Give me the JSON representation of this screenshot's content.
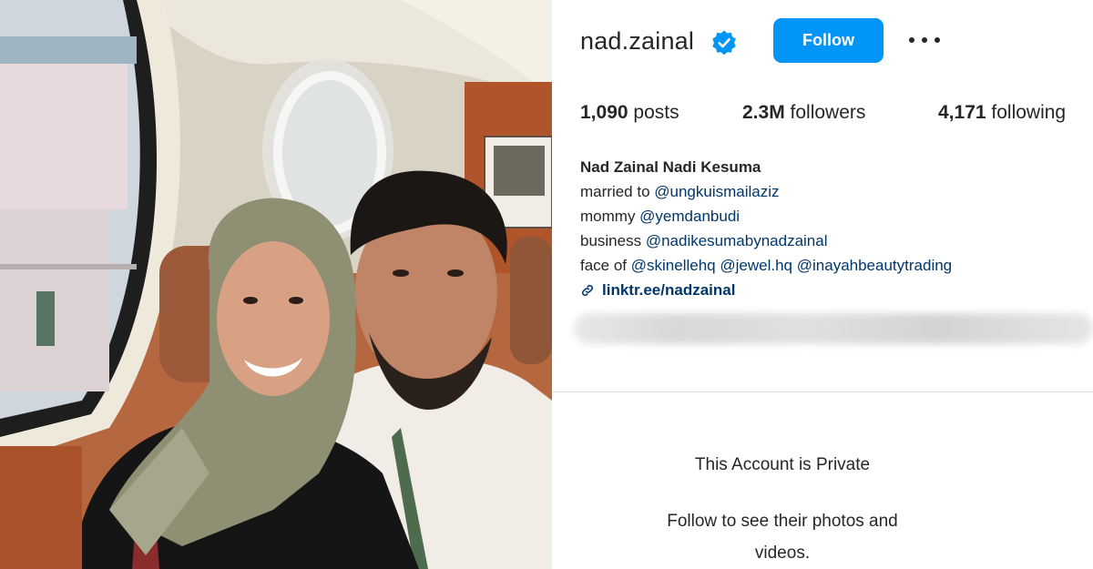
{
  "profile": {
    "username": "nad.zainal",
    "verified": true,
    "follow_label": "Follow",
    "more_icon": "more-horizontal-icon",
    "stats": {
      "posts_value": "1,090",
      "posts_label": " posts",
      "followers_value": "2.3M",
      "followers_label": " followers",
      "following_value": "4,171",
      "following_label": " following"
    },
    "bio": {
      "full_name": "Nad Zainal Nadi Kesuma",
      "line1_prefix": "married to ",
      "line1_mention": "@ungkuismailaziz",
      "line2_prefix": "mommy ",
      "line2_mention": "@yemdanbudi",
      "line3_prefix": "business ",
      "line3_mention": "@nadikesumabynadzainal",
      "line4_prefix": "face of ",
      "line4_mention1": "@skinellehq",
      "line4_mention2": "@jewel.hq",
      "line4_mention3": "@inayahbeautytrading",
      "link": "linktr.ee/nadzainal"
    },
    "private": {
      "title": "This Account is Private",
      "subtitle": "Follow to see their photos and videos."
    }
  },
  "colors": {
    "follow_button": "#0095f6",
    "verified_badge": "#0095f6",
    "mention": "#00376b",
    "text": "#262626",
    "divider": "#dbdbdb"
  }
}
